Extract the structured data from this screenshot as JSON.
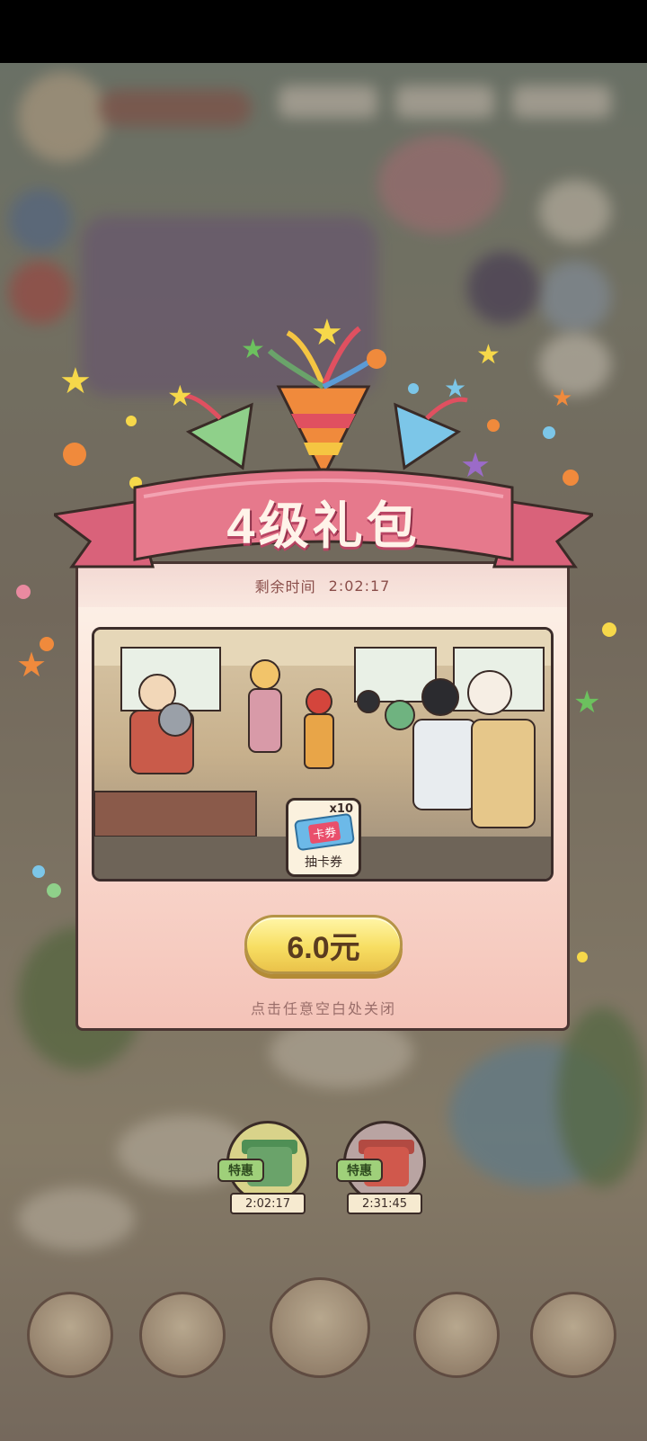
{
  "colors": {
    "ribbon": "#e6798c",
    "ribbon_dark": "#b84563",
    "panel": "#fbe1d6",
    "button_gold": "#f7de62",
    "text_brown": "#5a3b1f"
  },
  "popup": {
    "title": "4级礼包",
    "timer_label": "剩余时间",
    "timer_value": "2:02:17",
    "reward": {
      "icon": "gacha-ticket-icon",
      "card_text": "卡券",
      "count": "x10",
      "label": "抽卡券"
    },
    "price": "6.0元",
    "close_hint": "点击任意空白处关闭"
  },
  "bottom_gifts": [
    {
      "badge": "特惠",
      "timer": "2:02:17",
      "color": "#6aa36a"
    },
    {
      "badge": "特惠",
      "timer": "2:31:45",
      "color": "#d0584c"
    }
  ]
}
